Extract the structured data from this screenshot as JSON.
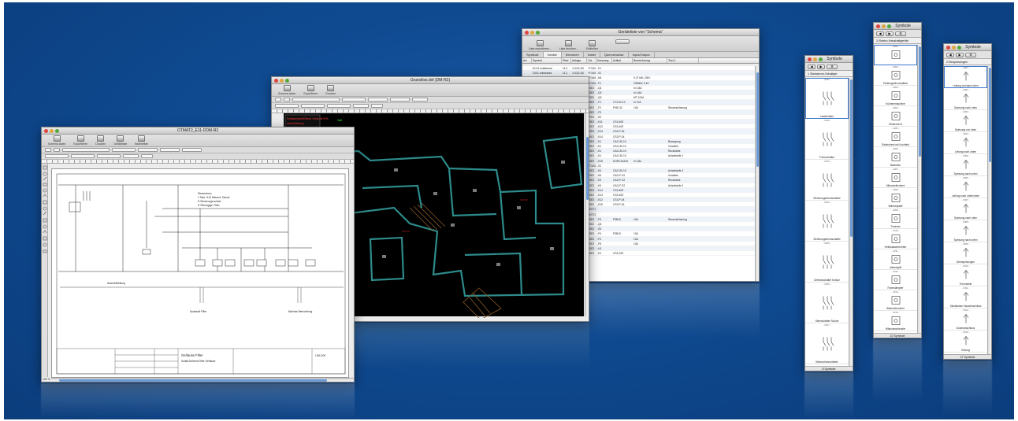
{
  "windows": {
    "schema": {
      "title": "OTMAT2_E11-DDM-R2",
      "toolbar": [
        "Schema laden",
        "Exportieren",
        "Drucken",
        "Geräteliste",
        "Bearbeiten"
      ],
      "info_lines": [
        "Steuerstrom",
        "1 Satz +110 Steuerd. Schutz",
        "D Steuerungs-schutz",
        "D Störung/ge. Filter"
      ],
      "label_bus": "Anschlußleitung",
      "labels_bottom": [
        "Hydraulik Filter",
        "Nächste Beleuchtung"
      ],
      "titleblock": {
        "project": "Gehäuse Filter",
        "desc": "Schalt-Schema Filter Gehäuse",
        "sheet": "LRA-D00"
      },
      "zoom": "100 %"
    },
    "floorplan": {
      "title": "Grundriss.dxf (DM-R2)",
      "toolbar": [
        "Schema laden",
        "Exportieren",
        "Drucken"
      ],
      "overlay_lines": [
        "Schaltschrank/Einheit: Gerät mit WTs",
        "Alarm/Meldung",
        "Schutzschalter"
      ],
      "overlay_tag": "Gaß"
    },
    "devices": {
      "title": "Geräteliste von \"Schema\"",
      "toolbar": [
        "Liste exportieren...",
        "Liste drucken...",
        "Schließen"
      ],
      "tabs": [
        "Symbole",
        "Geräte",
        "Klemmen",
        "Kabel",
        "Querverweise",
        "Input/Output"
      ],
      "columns": [
        "Art",
        "Symbol",
        "Pfad",
        "Anlage",
        "Ort",
        "Kennung",
        "Artikel",
        "Bezeichnung",
        "Text 1"
      ],
      "rows": [
        [
          "",
          "KC12 unbekannt",
          "11.0",
          "=1C31.D0",
          "+F1M1",
          "-K1",
          "",
          "",
          ""
        ],
        [
          "",
          "C001 unbekannt",
          "11.1",
          "=1C31.D0",
          "+F1M1",
          "-S1",
          "",
          "",
          ""
        ],
        [
          "",
          "",
          "11.4",
          "=1C31.D0",
          "+F1M1",
          "-M1",
          "",
          "0,37 kW, 230V",
          ""
        ],
        [
          "",
          "",
          "11.5",
          "=1C31.D0",
          "+F1M1",
          "-F1",
          "",
          "230MW, 5 kV",
          ""
        ],
        [
          "",
          "",
          "11.6",
          "=1C31.D0",
          "+SE2",
          "-Q1",
          "",
          "In 0,8A",
          ""
        ],
        [
          "",
          "",
          "11.6",
          "=1C31.D0",
          "+SE2",
          "-Q2",
          "",
          "In 0,8A",
          ""
        ],
        [
          "",
          "",
          "11.7",
          "=1C31.D0",
          "+SE2",
          "-Q3",
          "",
          "MT 100A",
          ""
        ],
        [
          "",
          "",
          "12.0",
          "=1C31.D0",
          "+SE2",
          "-F1",
          "C73-32-10",
          "In 10A",
          ""
        ],
        [
          "",
          "",
          "12.1",
          "=1C31.D0",
          "+SE2",
          "-F2",
          "PNE-32",
          "10A",
          "Steuersicherung"
        ],
        [
          "",
          "",
          "12.1",
          "=1C31.D0",
          "+SE2",
          "-F3",
          "",
          "",
          ""
        ],
        [
          "",
          "",
          "12.1",
          "=1C31.D0",
          "+PR1",
          "-S2",
          "",
          "",
          ""
        ],
        [
          "",
          "",
          "12.2",
          "=1C31.D0",
          "+SE2",
          "-K11",
          "CS3-40E",
          "",
          ""
        ],
        [
          "",
          "",
          "12.2",
          "=1C31.D0",
          "+SE2",
          "-K12",
          "CS3-40E",
          "",
          ""
        ],
        [
          "",
          "",
          "12.2",
          "=1C31.D0",
          "+SE2",
          "-K13",
          "CS3-P-04",
          "",
          ""
        ],
        [
          "",
          "",
          "12.3",
          "=1C31.D0",
          "+SE2",
          "-K14",
          "CS3-P-04",
          "",
          ""
        ],
        [
          "",
          "",
          "12.4",
          "=1C31.D0",
          "+SE2",
          "-K1",
          "CAO-30-10",
          "",
          "Bewegung"
        ],
        [
          "",
          "",
          "12.5",
          "=1C31.D0",
          "+SE2",
          "-K1",
          "CAO-30-10",
          "",
          "Vorwärts"
        ],
        [
          "",
          "",
          "12.6",
          "=1C31.D0",
          "+SE2",
          "-K1",
          "CAO-30-10",
          "",
          "Rückwärts"
        ],
        [
          "",
          "",
          "12.6",
          "=1C31.D0",
          "+SE2",
          "-K1",
          "CAO-30-10",
          "",
          "Anlaufstufe 1"
        ],
        [
          "",
          "",
          "12.7",
          "=1C31.D0",
          "+SE2",
          "-K15",
          "KORC10A10",
          "In 0,8s",
          ""
        ],
        [
          "",
          "",
          "13.1",
          "=1C31.D0",
          "+F1M1",
          "-S1",
          "",
          "",
          ""
        ],
        [
          "",
          "",
          "13.2",
          "=1C31.D0",
          "+SE2",
          "-K4",
          "CAO-30-10",
          "",
          "Anlaufstufe 2"
        ],
        [
          "",
          "",
          "13.5",
          "=1C31.D0",
          "+SE2",
          "-K3",
          "CAO-P-22",
          "",
          "Vorwärts"
        ],
        [
          "",
          "",
          "13.6",
          "=1C31.D0",
          "+SE2",
          "-K3",
          "CAO-P-22",
          "",
          "Rückwärts"
        ],
        [
          "",
          "",
          "13.6",
          "=1C31.D0",
          "+SE2",
          "-K4",
          "CAO-P-22",
          "",
          "Anlaufstufe 2"
        ],
        [
          "",
          "",
          "13.8",
          "=1C31.D0",
          "+SE2",
          "-K14",
          "CS3-40E",
          "",
          ""
        ],
        [
          "",
          "",
          "13.8",
          "=1C31.D0",
          "+SE2",
          "-K13",
          "CS3-40E",
          "",
          ""
        ],
        [
          "",
          "",
          "14.1",
          "=1C31.D0",
          "+SE2",
          "-K12",
          "CS3-P-04",
          "",
          ""
        ],
        [
          "",
          "",
          "14.3",
          "=1C31.D0",
          "+SE2",
          "-K15",
          "CS3-P-04",
          "",
          ""
        ],
        [
          "",
          "",
          "14.6",
          "=1C31.D0",
          "+KST1",
          "",
          "",
          "",
          ""
        ],
        [
          "",
          "",
          "14.8",
          "=1C31.D0",
          "+KST2",
          "",
          "",
          "",
          ""
        ],
        [
          "",
          "",
          "15.1",
          "=1C31.D0",
          "+SE2",
          "-F3",
          "P3B10",
          "10A",
          "Steuersicherung"
        ],
        [
          "",
          "",
          "15.1",
          "=1C31.D0",
          "+SE2",
          "-Q2",
          "",
          "",
          ""
        ],
        [
          "",
          "",
          "15.4",
          "=1C31.D0",
          "+SE2",
          "-S3",
          "",
          "",
          ""
        ],
        [
          "",
          "",
          "16.2",
          "=1C31.D0",
          "+SE2",
          "-F4",
          "P3B10",
          "10A",
          ""
        ],
        [
          "",
          "",
          "16.3",
          "=1C31.D0",
          "+SE2",
          "-F4",
          "",
          "10A",
          ""
        ],
        [
          "",
          "",
          "16.5",
          "=1C31.D0",
          "+SE2",
          "-F5",
          "",
          "10A",
          ""
        ],
        [
          "",
          "",
          "16.6",
          "=1C31.D0",
          "+SE2",
          "-H1",
          "",
          "",
          ""
        ],
        [
          "",
          "",
          "16.6",
          "=1C31.D0",
          "+SE2",
          "-K1",
          "CS3-10E",
          "",
          ""
        ]
      ]
    },
    "palette1": {
      "title": "Symbole",
      "category": "1 Starkstrom-Schaltger",
      "count": "8 Symbole",
      "items": [
        {
          "id": "- 3101 -",
          "label": "Lastschalter"
        },
        {
          "id": "- 3102 -",
          "label": "Trennschalter"
        },
        {
          "id": "- 3103 -",
          "label": "Sicherungstrennschalter"
        },
        {
          "id": "- 3104 -",
          "label": "Sicherungstrennschalter"
        },
        {
          "id": "- 3105 -",
          "label": "Dreieckschalter Schutz"
        },
        {
          "id": "- 3106 -",
          "label": "Sternschalter Schutz"
        },
        {
          "id": "- 3107 -",
          "label": "Motorschutzschalter"
        }
      ]
    },
    "palette2": {
      "title": "Symbole",
      "category": "3 Elektro-Haushaltgeräte",
      "count": "22 Symbole",
      "items": [
        {
          "id": "- 3201 -",
          "label": ""
        },
        {
          "id": "- 3202 -",
          "label": "Elektrogerät schaltbar"
        },
        {
          "id": "- 3203 -",
          "label": "Küchenmaschine"
        },
        {
          "id": "- 3204 -",
          "label": "Elektroherd"
        },
        {
          "id": "- 3205 -",
          "label": "Elektroherd mit Kochfeld"
        },
        {
          "id": "- 3206 -",
          "label": "Backofen"
        },
        {
          "id": "- 3207 -",
          "label": "Mikrowellenherd"
        },
        {
          "id": "- 3208 -",
          "label": "Wärmeplatte"
        },
        {
          "id": "- 3209 -",
          "label": "Trockner"
        },
        {
          "id": "- 3210 -",
          "label": "Heißwasserbereiter"
        },
        {
          "id": "- 3211 -",
          "label": "Infrarotgrill"
        },
        {
          "id": "- 3212 -",
          "label": "Futterdämpfer"
        },
        {
          "id": "- 3213 -",
          "label": "Wäschetrockner"
        },
        {
          "id": "- 3214 -",
          "label": "Wäscheschleuder"
        }
      ]
    },
    "palette3": {
      "title": "Symbole",
      "category": "2 Einspeisungen",
      "count": "27 Symbole",
      "items": [
        {
          "id": "- 3301 -",
          "label": "Leitung von/nach oben"
        },
        {
          "id": "- 3302 -",
          "label": "Speisung nach oben"
        },
        {
          "id": "- 3303 -",
          "label": "Speisung von oben"
        },
        {
          "id": "- 3304 -",
          "label": "Leitung nach unten"
        },
        {
          "id": "- 3305 -",
          "label": "Speisung nach unten"
        },
        {
          "id": "- 3306 -",
          "label": "Leitung nach unten/oben"
        },
        {
          "id": "- 3307 -",
          "label": "Speisung nach oben"
        },
        {
          "id": "- 3308 -",
          "label": "Speisung nach unten"
        },
        {
          "id": "- 3309 -",
          "label": "Überspeisungen"
        },
        {
          "id": "- 3310 -",
          "label": "Trennstelle"
        },
        {
          "id": "- 3311 -",
          "label": "Steckdosen Hauseinschluss"
        },
        {
          "id": "- 3312 -",
          "label": "Dosenanschluss"
        },
        {
          "id": "- 3313 -",
          "label": "Erdung"
        }
      ]
    }
  }
}
